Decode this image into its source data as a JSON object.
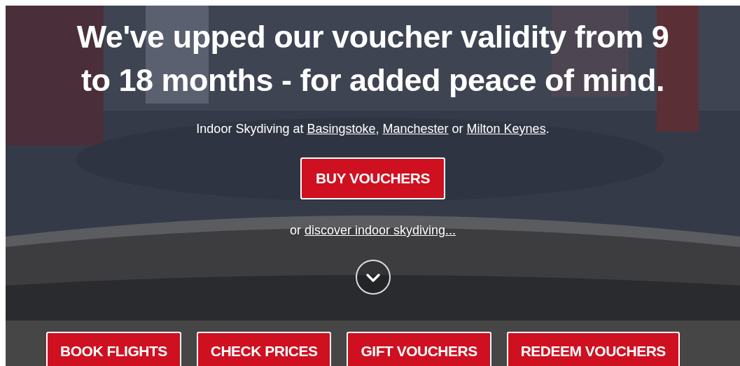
{
  "hero": {
    "kind": "picture",
    "headline": "We've upped our voucher validity from 9 to 18 months - for added peace of mind.",
    "intro": [
      {
        "kind": "text",
        "text": "Indoor Skydiving at "
      },
      {
        "kind": "link",
        "text": "Basingstoke"
      },
      {
        "kind": "text",
        "text": ", "
      },
      {
        "kind": "link",
        "text": "Manchester"
      },
      {
        "kind": "text",
        "text": " or "
      },
      {
        "kind": "link",
        "text": "Milton Keynes"
      },
      {
        "kind": "text",
        "text": "."
      }
    ],
    "cta": "BUY VOUCHERS",
    "discover": [
      {
        "kind": "text",
        "text": "or "
      },
      {
        "kind": "link",
        "text": "discover indoor skydiving..."
      }
    ]
  },
  "action_bar": {
    "buttons": [
      "BOOK FLIGHTS",
      "CHECK PRICES",
      "GIFT VOUCHERS",
      "REDEEM VOUCHERS"
    ]
  }
}
